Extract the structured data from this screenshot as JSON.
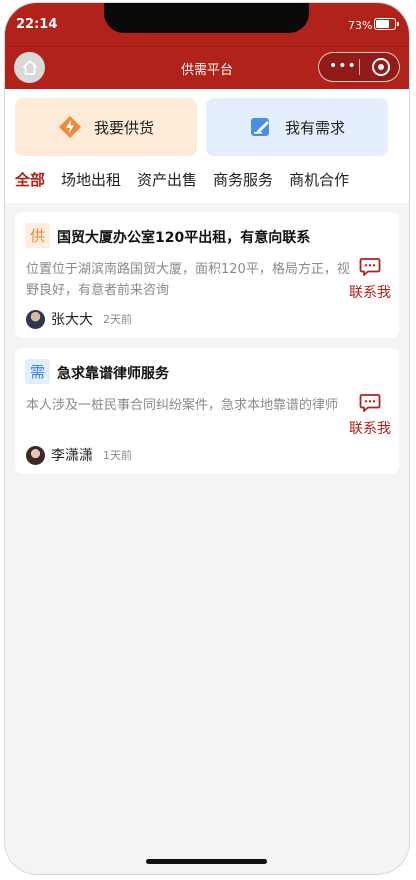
{
  "status_bar": {
    "time": "22:14",
    "battery": "73%"
  },
  "nav": {
    "title": "供需平台",
    "more_dots": "•••"
  },
  "actions": {
    "supply_label": "我要供货",
    "demand_label": "我有需求"
  },
  "tabs": [
    {
      "label": "全部",
      "active": true
    },
    {
      "label": "场地出租"
    },
    {
      "label": "资产出售"
    },
    {
      "label": "商务服务"
    },
    {
      "label": "商机合作"
    }
  ],
  "posts": [
    {
      "tag": "供",
      "title": "国贸大厦办公室120平出租，有意向联系",
      "description": "位置位于湖滨南路国贸大厦，面积120平，格局方正，视野良好，有意者前来咨询",
      "user": "张大大",
      "time": "2天前",
      "contact_label": "联系我"
    },
    {
      "tag": "需",
      "title": "急求靠谱律师服务",
      "description": "本人涉及一桩民事合同纠纷案件，急求本地靠谱的律师",
      "user": "李潇潇",
      "time": "1天前",
      "contact_label": "联系我"
    }
  ],
  "colors": {
    "brand": "#b1221b",
    "supply_tag": "#ee8a38",
    "demand_tag": "#3a82d4"
  }
}
